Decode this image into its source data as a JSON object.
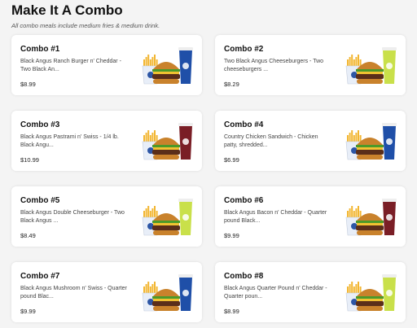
{
  "section": {
    "title": "Make It A Combo",
    "subtitle": "All combo meals include medium fries & medium drink."
  },
  "combos": [
    {
      "name": "Combo #1",
      "description": "Black Angus Ranch Burger n' Cheddar - Two Black An...",
      "price": "$8.99",
      "drink": "pepsi",
      "icon": "ranch-burger-combo-icon"
    },
    {
      "name": "Combo #2",
      "description": "Two Black Angus Cheeseburgers - Two cheeseburgers ...",
      "price": "$8.29",
      "drink": "mtn-dew",
      "icon": "cheeseburger-combo-icon"
    },
    {
      "name": "Combo #3",
      "description": "Black Angus Pastrami n' Swiss - 1/4 lb. Black Angu...",
      "price": "$10.99",
      "drink": "dr-pepper",
      "icon": "pastrami-combo-icon"
    },
    {
      "name": "Combo #4",
      "description": "Country Chicken Sandwich - Chicken patty, shredded...",
      "price": "$6.99",
      "drink": "pepsi",
      "icon": "chicken-sandwich-combo-icon"
    },
    {
      "name": "Combo #5",
      "description": "Black Angus Double Cheeseburger - Two Black Angus ...",
      "price": "$8.49",
      "drink": "mtn-dew",
      "icon": "double-cheeseburger-combo-icon"
    },
    {
      "name": "Combo #6",
      "description": "Black Angus Bacon n' Cheddar - Quarter pound Black...",
      "price": "$9.99",
      "drink": "dr-pepper",
      "icon": "bacon-burger-combo-icon"
    },
    {
      "name": "Combo #7",
      "description": "Black Angus Mushroom n' Swiss - Quarter pound Blac...",
      "price": "$9.99",
      "drink": "pepsi",
      "icon": "mushroom-burger-combo-icon"
    },
    {
      "name": "Combo #8",
      "description": "Black Angus Quarter Pound n' Cheddar - Quarter poun...",
      "price": "$8.99",
      "drink": "mtn-dew",
      "icon": "quarter-pound-combo-icon"
    }
  ],
  "colors": {
    "page_bg": "#f4f4f4",
    "card_bg": "#ffffff",
    "fries": "#f2b632",
    "fries_box": "#e8eef8",
    "bun": "#c9822c",
    "patty": "#5a2e1a",
    "lettuce": "#4c9a2a",
    "cheese": "#f1c232",
    "pepsi": "#1f4fa8",
    "mtn_dew": "#c9e04a",
    "dr_pepper": "#7a1e26"
  }
}
